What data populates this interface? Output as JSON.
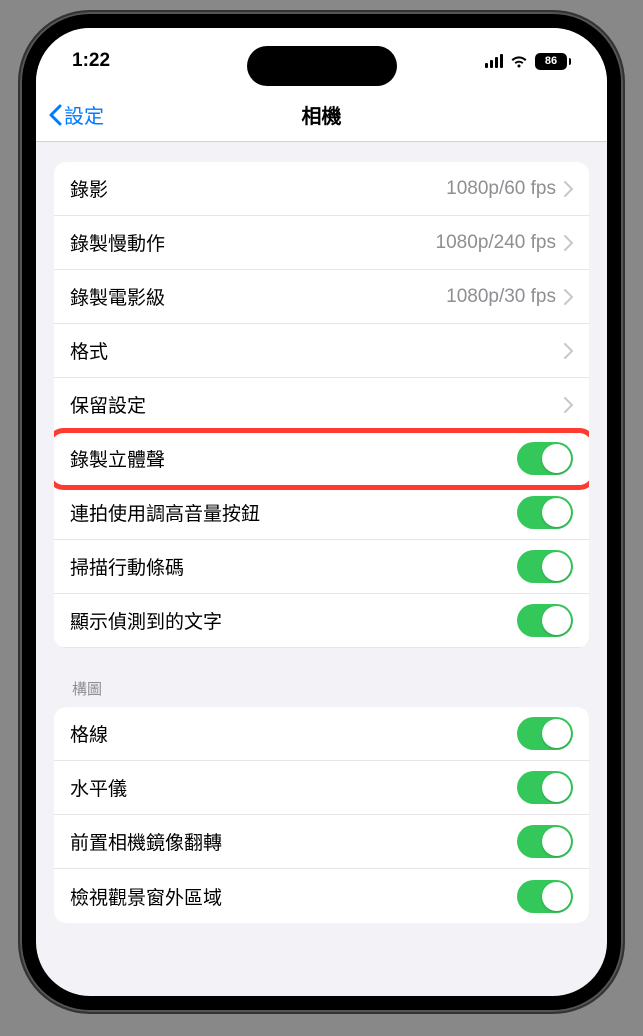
{
  "status": {
    "time": "1:22",
    "battery": "86"
  },
  "nav": {
    "back_label": "設定",
    "title": "相機"
  },
  "group1": {
    "rows": [
      {
        "label": "錄影",
        "value": "1080p/60 fps"
      },
      {
        "label": "錄製慢動作",
        "value": "1080p/240 fps"
      },
      {
        "label": "錄製電影級",
        "value": "1080p/30 fps"
      },
      {
        "label": "格式",
        "value": ""
      },
      {
        "label": "保留設定",
        "value": ""
      }
    ],
    "toggles": [
      {
        "label": "錄製立體聲",
        "on": true,
        "highlight": true
      },
      {
        "label": "連拍使用調高音量按鈕",
        "on": true
      },
      {
        "label": "掃描行動條碼",
        "on": true
      },
      {
        "label": "顯示偵測到的文字",
        "on": true
      }
    ]
  },
  "group2": {
    "header": "構圖",
    "toggles": [
      {
        "label": "格線",
        "on": true
      },
      {
        "label": "水平儀",
        "on": true
      },
      {
        "label": "前置相機鏡像翻轉",
        "on": true
      },
      {
        "label": "檢視觀景窗外區域",
        "on": true
      }
    ]
  }
}
